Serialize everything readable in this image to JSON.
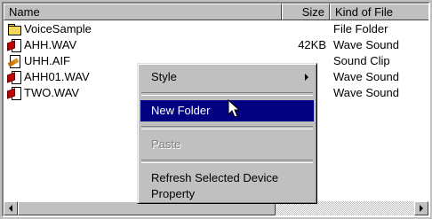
{
  "columns": {
    "name": "Name",
    "size": "Size",
    "kind": "Kind of File"
  },
  "files": [
    {
      "name": "VoiceSample",
      "size": "",
      "kind": "File Folder",
      "icon": "folder-icon"
    },
    {
      "name": "AHH.WAV",
      "size": "42KB",
      "kind": "Wave Sound",
      "icon": "wave-sound-icon"
    },
    {
      "name": "UHH.AIF",
      "size": "",
      "kind": "Sound Clip",
      "icon": "sound-clip-icon"
    },
    {
      "name": "AHH01.WAV",
      "size": "",
      "kind": "Wave Sound",
      "icon": "wave-sound-icon"
    },
    {
      "name": "TWO.WAV",
      "size": "",
      "kind": "Wave Sound",
      "icon": "wave-sound-icon"
    }
  ],
  "context_menu": {
    "style": "Style",
    "new_folder": "New Folder",
    "paste": "Paste",
    "refresh": "Refresh Selected Device",
    "property": "Property"
  },
  "colors": {
    "highlight": "#000080",
    "face": "#c0c0c0"
  }
}
